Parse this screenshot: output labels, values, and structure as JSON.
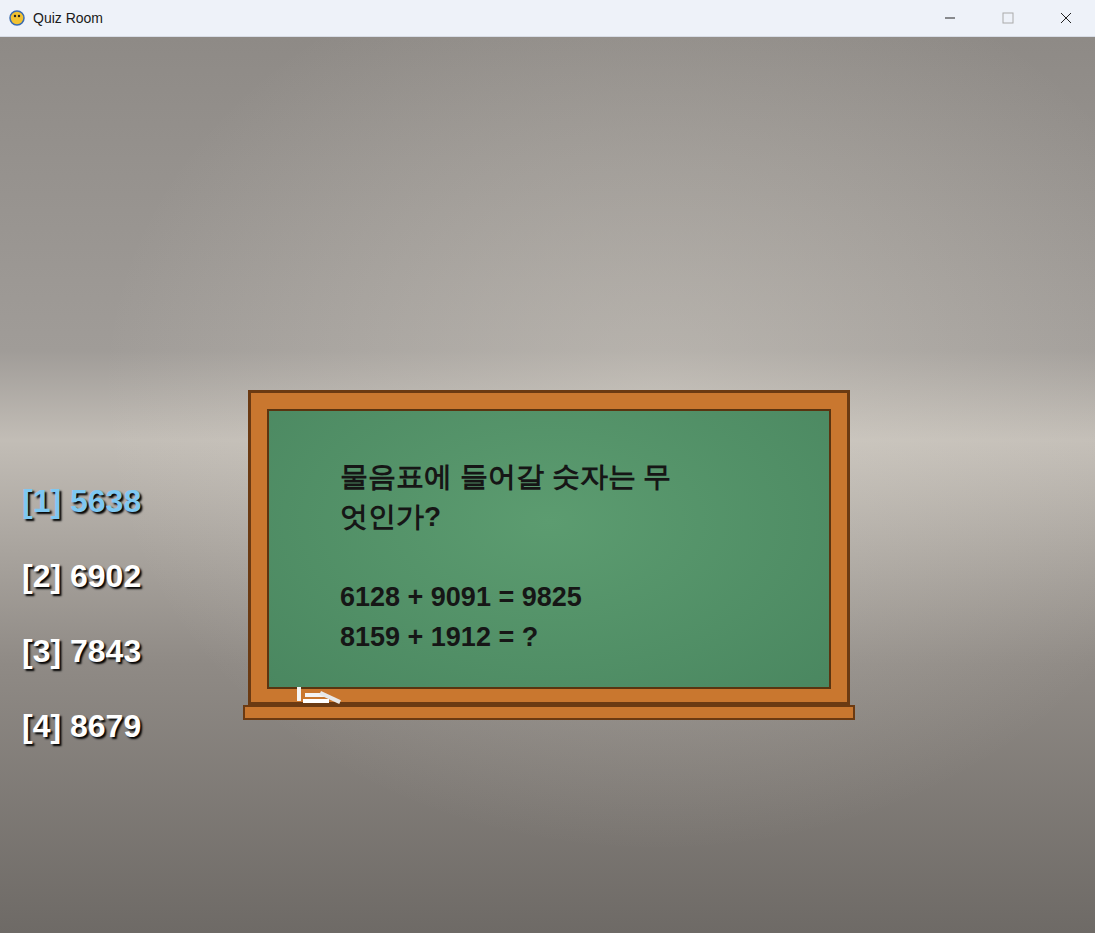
{
  "window": {
    "title": "Quiz Room"
  },
  "question": {
    "lines": [
      "물음표에 들어갈 숫자는 무",
      "엇인가?"
    ],
    "equations": [
      "6128 + 9091 = 9825",
      "8159 + 1912 = ?"
    ]
  },
  "options": [
    {
      "label": "[1] 5638",
      "selected": true
    },
    {
      "label": "[2] 6902",
      "selected": false
    },
    {
      "label": "[3] 7843",
      "selected": false
    },
    {
      "label": "[4] 8679",
      "selected": false
    }
  ]
}
